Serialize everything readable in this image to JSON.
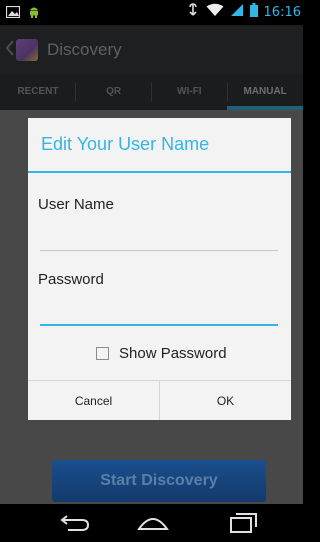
{
  "status_bar": {
    "time": "16:16",
    "icons": [
      "image-icon",
      "android-icon",
      "usb-icon",
      "wifi-icon",
      "signal-icon",
      "battery-icon"
    ]
  },
  "action_bar": {
    "title": "Discovery",
    "back_icon": "chevron-left-icon",
    "logo_icon": "app-logo-icon"
  },
  "tabs": [
    {
      "label": "RECENT",
      "selected": false
    },
    {
      "label": "QR",
      "selected": false
    },
    {
      "label": "WI-FI",
      "selected": false
    },
    {
      "label": "MANUAL",
      "selected": true
    }
  ],
  "dialog": {
    "title": "Edit Your User Name",
    "username_label": "User Name",
    "username_value": "",
    "password_label": "Password",
    "password_value": "",
    "show_password_label": "Show Password",
    "show_password_checked": false,
    "cancel_label": "Cancel",
    "ok_label": "OK"
  },
  "main": {
    "start_button_label": "Start Discovery"
  },
  "nav_bar": {
    "icons": [
      "back-icon",
      "home-icon",
      "recents-icon"
    ]
  },
  "colors": {
    "accent": "#33b5e5",
    "button_blue": "#1a4f8e"
  }
}
